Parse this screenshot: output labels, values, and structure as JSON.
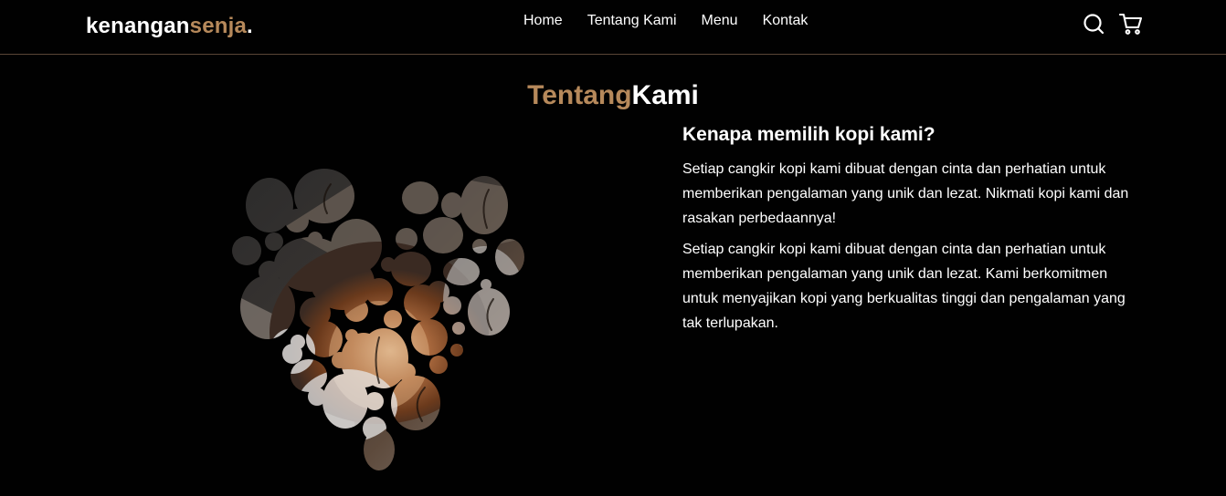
{
  "navbar": {
    "logo_main": "kenangan",
    "logo_accent": "senja",
    "logo_dot": ".",
    "links": [
      "Home",
      "Tentang Kami",
      "Menu",
      "Kontak"
    ],
    "icons": [
      "search-icon",
      "shopping-cart-icon"
    ]
  },
  "about": {
    "title_accent": "Tentang",
    "title_main": "Kami",
    "image_icon": "coffee-beans-heart-image",
    "heading": "Kenapa memilih kopi kami?",
    "paragraph1": "Setiap cangkir kopi kami dibuat dengan cinta dan perhatian untuk memberikan pengalaman yang unik dan lezat. Nikmati kopi kami dan rasakan perbedaannya!",
    "paragraph2": "Setiap cangkir kopi kami dibuat dengan cinta dan perhatian untuk memberikan pengalaman yang unik dan lezat. Kami berkomitmen untuk menyajikan kopi yang berkualitas tinggi dan pengalaman yang tak terlupakan."
  },
  "colors": {
    "background": "#010101",
    "accent": "#b6895b",
    "text": "#ffffff",
    "divider": "#5a4636"
  }
}
